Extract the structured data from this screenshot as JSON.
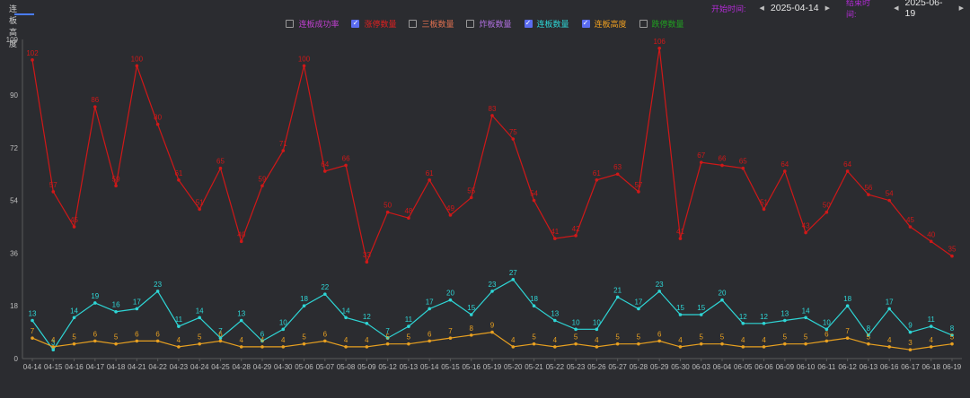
{
  "tab": {
    "label": "连板高度"
  },
  "start": {
    "label": "开始时间:",
    "value": "2025-04-14"
  },
  "end": {
    "label": "结束时间:",
    "value": "2025-06-19"
  },
  "legend": [
    {
      "label": "连板成功率",
      "checked": false,
      "color": "#c040d0"
    },
    {
      "label": "涨停数量",
      "checked": true,
      "color": "#e02020"
    },
    {
      "label": "三板数量",
      "checked": false,
      "color": "#e07050"
    },
    {
      "label": "炸板数量",
      "checked": false,
      "color": "#b070e0"
    },
    {
      "label": "连板数量",
      "checked": true,
      "color": "#2ed6d6"
    },
    {
      "label": "连板高度",
      "checked": true,
      "color": "#f0a020"
    },
    {
      "label": "跌停数量",
      "checked": false,
      "color": "#20a020"
    }
  ],
  "chart_data": {
    "type": "line",
    "ylim": [
      0,
      109
    ],
    "yticks": [
      0,
      18,
      36,
      54,
      72,
      90,
      109
    ],
    "categories": [
      "04-14",
      "04-15",
      "04-16",
      "04-17",
      "04-18",
      "04-21",
      "04-22",
      "04-23",
      "04-24",
      "04-25",
      "04-28",
      "04-29",
      "04-30",
      "05-06",
      "05-07",
      "05-08",
      "05-09",
      "05-12",
      "05-13",
      "05-14",
      "05-15",
      "05-16",
      "05-19",
      "05-20",
      "05-21",
      "05-22",
      "05-23",
      "05-26",
      "05-27",
      "05-28",
      "05-29",
      "05-30",
      "06-03",
      "06-04",
      "06-05",
      "06-06",
      "06-09",
      "06-10",
      "06-11",
      "06-12",
      "06-13",
      "06-16",
      "06-17",
      "06-18",
      "06-19"
    ],
    "series": [
      {
        "name": "涨停数量",
        "color": "#d01818",
        "values": [
          102,
          57,
          45,
          86,
          59,
          100,
          80,
          61,
          51,
          65,
          40,
          59,
          71,
          100,
          64,
          66,
          33,
          50,
          48,
          61,
          49,
          55,
          83,
          75,
          54,
          41,
          42,
          61,
          63,
          57,
          106,
          41,
          67,
          66,
          65,
          51,
          64,
          43,
          50,
          64,
          56,
          54,
          45,
          40,
          35
        ]
      },
      {
        "name": "连板数量",
        "color": "#2ed6d6",
        "values": [
          13,
          3,
          14,
          19,
          16,
          17,
          23,
          11,
          14,
          7,
          13,
          6,
          10,
          18,
          22,
          14,
          12,
          7,
          11,
          17,
          20,
          15,
          23,
          27,
          18,
          13,
          10,
          10,
          21,
          17,
          23,
          15,
          15,
          20,
          12,
          12,
          13,
          14,
          10,
          18,
          8,
          17,
          9,
          11,
          8
        ]
      },
      {
        "name": "连板高度",
        "color": "#e8a020",
        "values": [
          7,
          4,
          5,
          6,
          5,
          6,
          6,
          4,
          5,
          6,
          4,
          4,
          4,
          5,
          6,
          4,
          4,
          5,
          5,
          6,
          7,
          8,
          9,
          4,
          5,
          4,
          5,
          4,
          5,
          5,
          6,
          4,
          5,
          5,
          4,
          4,
          5,
          5,
          6,
          7,
          5,
          4,
          3,
          4,
          5
        ]
      }
    ]
  }
}
